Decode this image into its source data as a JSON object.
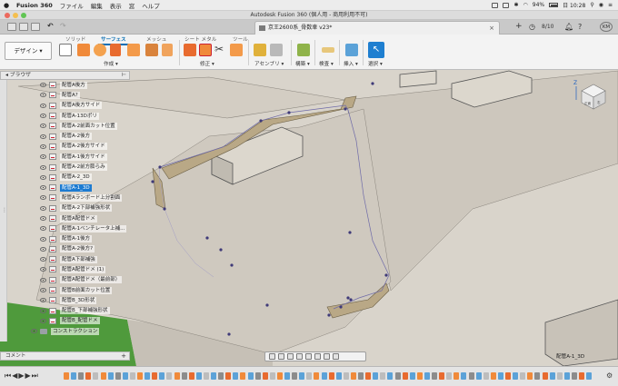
{
  "menubar": {
    "app_name": "Fusion 360",
    "items": [
      "ファイル",
      "編集",
      "表示",
      "窓",
      "ヘルプ"
    ],
    "battery": "94%",
    "time": "日 10:28"
  },
  "window": {
    "title": "Autodesk Fusion 360 (個人用 - 商用利用不可)"
  },
  "document_tab": {
    "label": "京王2600系_骨数車 v23*"
  },
  "quick_access": {
    "jobs_count": "8/10",
    "user_initials": "KM"
  },
  "ribbon": {
    "workspace_label": "デザイン",
    "tabs": [
      "ソリッド",
      "サーフェス",
      "メッシュ",
      "シート メタル",
      "ツール"
    ],
    "active_tab": "サーフェス",
    "groups": [
      "作成",
      "修正",
      "アセンブリ",
      "構築",
      "検査",
      "挿入",
      "選択"
    ]
  },
  "browser": {
    "header": "ブラウザ",
    "items": [
      "配管A後方",
      "配管A?",
      "配管A後方サイド",
      "配管A-13Dポリ",
      "配管A-2前面カット位置",
      "配管A-2後方",
      "配管A-2後方サイド",
      "配管A-1後方サイド",
      "配管A-2前方膨らみ",
      "配管A-2_3D",
      "配管A-1_3D",
      "配管Aランボード上分割面",
      "配管A-2下部補強形状",
      "配管A配管ドメ",
      "配管A-1ベンチレータ上補...",
      "配管A-1後方",
      "配管A-2後方?",
      "配管A下部補強",
      "配管A配管ドメ (1)",
      "配管A配管ドメ（最前部）",
      "配管B前面カット位置",
      "配管B_3D形状",
      "配管B_下部補強形状",
      "配管B_配管ドメ"
    ],
    "selected_index": 10,
    "construction_folder": "コンストラクション"
  },
  "comments": {
    "label": "コメント"
  },
  "status": {
    "selection_name": "配管A-1_3D"
  },
  "viewcube": {
    "axis_z": "Z",
    "face": "正面",
    "side": "右"
  },
  "colors": {
    "accent": "#0a6fb5",
    "selection": "#1d7bd1",
    "body": "#b9a886",
    "viewport_bg": "#d9d4cb",
    "ground_green": "#4f9a3c"
  }
}
